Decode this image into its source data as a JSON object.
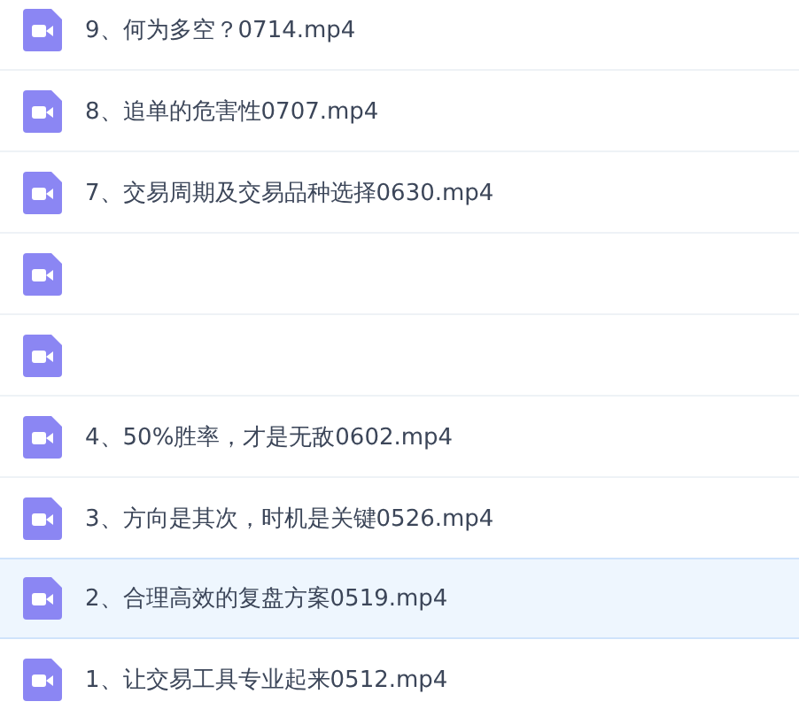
{
  "files": [
    {
      "name": "9、何为多空？0714.mp4",
      "selected": false
    },
    {
      "name": "8、追单的危害性0707.mp4",
      "selected": false
    },
    {
      "name": "7、交易周期及交易品种选择0630.mp4",
      "selected": false
    },
    {
      "selected": false
    },
    {
      "selected": false
    },
    {
      "name": "4、50%胜率，才是无敌0602.mp4",
      "selected": false
    },
    {
      "name": "3、方向是其次，时机是关键0526.mp4",
      "selected": false
    },
    {
      "name": "2、合理高效的复盘方案0519.mp4",
      "selected": true
    },
    {
      "name": "1、让交易工具专业起来0512.mp4",
      "selected": false
    }
  ]
}
